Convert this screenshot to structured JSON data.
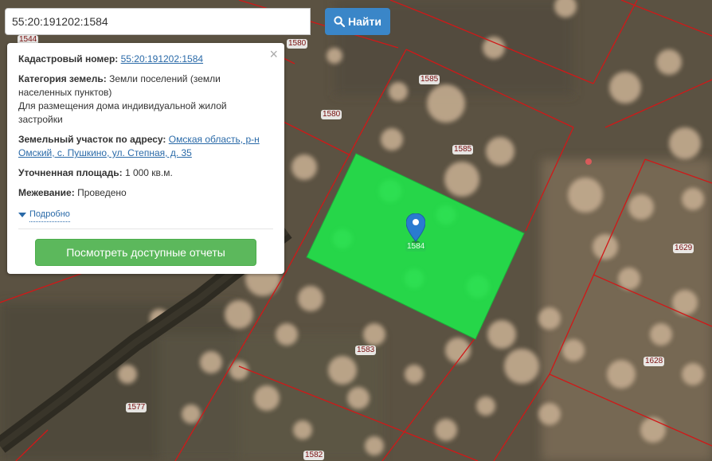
{
  "search": {
    "value": "55:20:191202:1584",
    "button_label": "Найти"
  },
  "popup": {
    "cadastral_label": "Кадастровый номер:",
    "cadastral_value": "55:20:191202:1584",
    "category_label": "Категория земель:",
    "category_value": "Земли поселений (земли населенных пунктов)",
    "usage_value": "Для размещения дома индивидуальной жилой застройки",
    "address_label": "Земельный участок по адресу:",
    "address_value": "Омская область, р-н Омский, с. Пушкино, ул. Степная, д. 35",
    "area_label": "Уточненная площадь:",
    "area_value": "1 000 кв.м.",
    "survey_label": "Межевание:",
    "survey_value": "Проведено",
    "details_label": "Подробно",
    "reports_button": "Посмотреть доступные отчеты",
    "close_symbol": "×"
  },
  "parcels": {
    "p1544": "1544",
    "p1580a": "1580",
    "p1585a": "1585",
    "p1580b": "1580",
    "p1585b": "1585",
    "p1584": "1584",
    "p1629": "1629",
    "p1583": "1583",
    "p1628": "1628",
    "p1577": "1577",
    "p1582": "1582"
  },
  "colors": {
    "selected_parcel": "#22e24a",
    "parcel_border": "#d01818",
    "marker": "#2a7bd0",
    "search_button": "#3a86c8",
    "reports_button": "#5cb85c"
  },
  "icons": {
    "search": "search-icon",
    "marker": "map-marker-icon",
    "close": "close-icon",
    "caret": "caret-down-icon"
  }
}
